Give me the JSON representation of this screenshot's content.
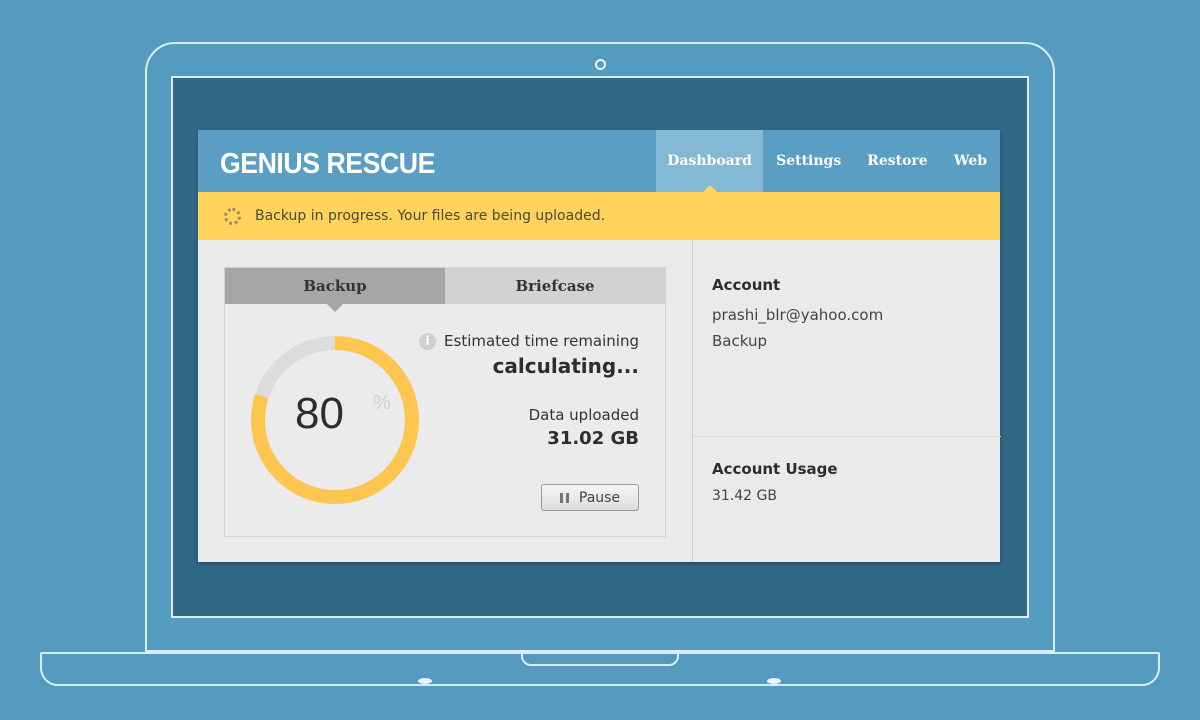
{
  "app": {
    "brand": "GENIUS RESCUE",
    "nav": [
      {
        "label": "Dashboard",
        "active": true
      },
      {
        "label": "Settings",
        "active": false
      },
      {
        "label": "Restore",
        "active": false
      },
      {
        "label": "Web",
        "active": false
      }
    ]
  },
  "banner": {
    "icon": "spinner-icon",
    "text": "Backup in progress. Your files are being uploaded.",
    "color": "#ffd35c"
  },
  "backup_card": {
    "tabs": [
      {
        "label": "Backup",
        "active": true
      },
      {
        "label": "Briefcase",
        "active": false
      }
    ],
    "progress": {
      "value": "80",
      "unit": "%",
      "fraction": 0.8,
      "ring_color": "#ffc64f",
      "track_color": "#dcdcdc"
    },
    "eta_label": "Estimated time remaining",
    "eta_value": "calculating...",
    "uploaded_label": "Data uploaded",
    "uploaded_value": "31.02 GB",
    "pause_label": "Pause"
  },
  "account": {
    "title": "Account",
    "email": "prashi_blr@yahoo.com",
    "plan": "Backup",
    "usage_title": "Account Usage",
    "usage_value": "31.42 GB"
  },
  "colors": {
    "background": "#559bbf",
    "header": "#5a9fc3",
    "nav_active": "#83b9d5",
    "banner": "#ffd35c"
  }
}
